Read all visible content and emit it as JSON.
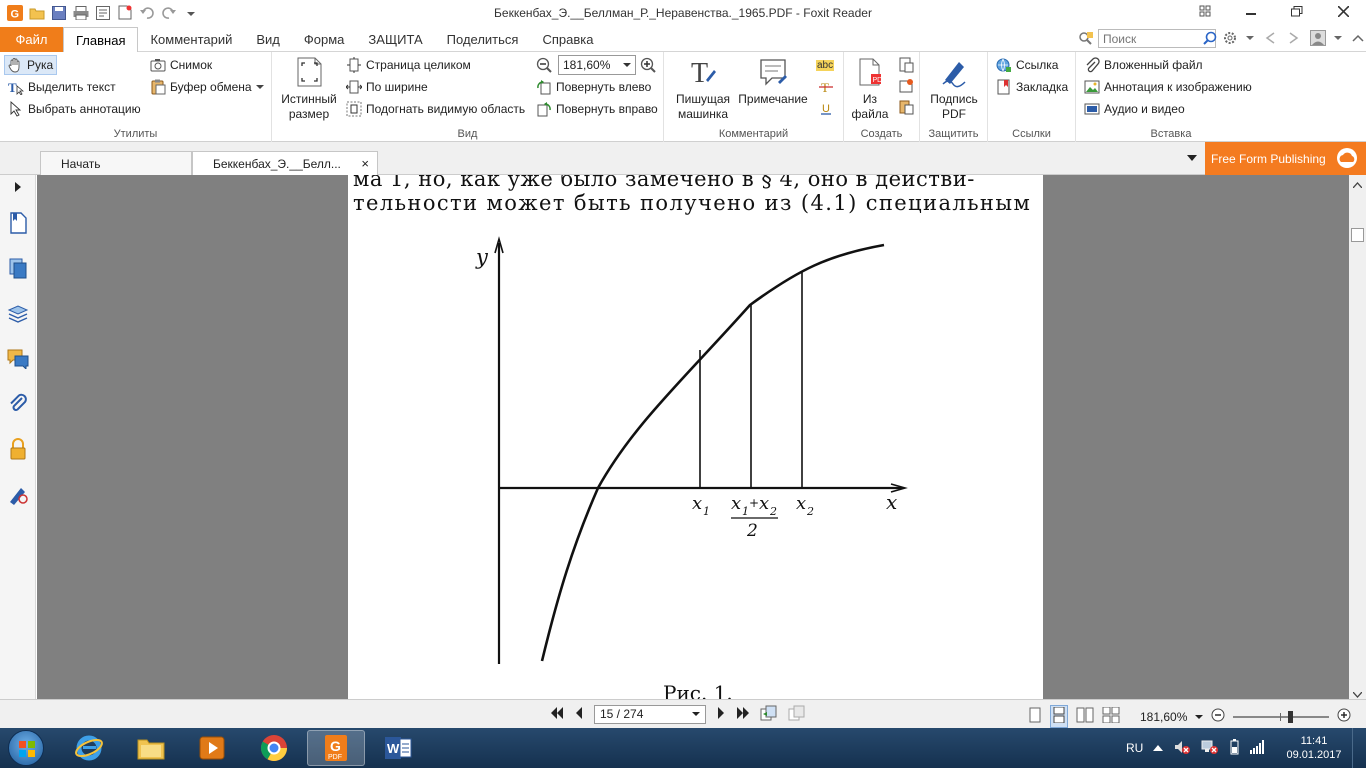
{
  "window": {
    "title": "Беккенбах_Э.__Беллман_Р._Неравенства._1965.PDF - Foxit Reader"
  },
  "menu": {
    "file": "Файл",
    "tabs": [
      "Главная",
      "Комментарий",
      "Вид",
      "Форма",
      "ЗАЩИТА",
      "Поделиться",
      "Справка"
    ]
  },
  "search": {
    "placeholder": "Поиск"
  },
  "ribbon": {
    "utilities": {
      "label": "Утилиты",
      "hand": "Рука",
      "select_text": "Выделить текст",
      "select_annotation": "Выбрать аннотацию",
      "snapshot": "Снимок",
      "clipboard": "Буфер обмена"
    },
    "view": {
      "label": "Вид",
      "actual_size": "Истинный размер",
      "fit_page": "Страница целиком",
      "fit_width": "По ширине",
      "fit_visible": "Подогнать видимую область",
      "zoom": "181,60%",
      "rotate_left": "Повернуть влево",
      "rotate_right": "Повернуть вправо"
    },
    "comment": {
      "label": "Комментарий",
      "typewriter": "Пишущая машинка",
      "note": "Примечание",
      "abc": "abc"
    },
    "create": {
      "label": "Создать",
      "from_file": "Из файла"
    },
    "protect": {
      "label": "Защитить",
      "sign_pdf": "Подпись PDF"
    },
    "links": {
      "label": "Ссылки",
      "link": "Ссылка",
      "bookmark": "Закладка"
    },
    "insert": {
      "label": "Вставка",
      "attached_file": "Вложенный файл",
      "image_annotation": "Аннотация к изображению",
      "audio_video": "Аудио и видео"
    }
  },
  "doc_tabs": {
    "start": "Начать",
    "document": "Беккенбах_Э.__Белл...",
    "close": "×",
    "promo": "Free Form Publishing"
  },
  "page": {
    "line1": "ма 1, но, как уже было замечено в § 4, оно в действи-",
    "line2": "тельности может быть получено из (4.1) специальным",
    "caption": "Рис. 1.",
    "figure": {
      "y_label": "y",
      "x_label": "x",
      "x1_label": "x",
      "x1_sub": "1",
      "mid_num_a": "x",
      "mid_num_a_sub": "1",
      "mid_plus": "+",
      "mid_num_b": "x",
      "mid_num_b_sub": "2",
      "mid_den": "2",
      "x2_label": "x",
      "x2_sub": "2"
    }
  },
  "statusbar": {
    "page_indicator": "15 / 274",
    "zoom": "181,60%"
  },
  "taskbar": {
    "language": "RU",
    "time": "11:41",
    "date": "09.01.2017"
  },
  "colors": {
    "accent_orange": "#f07d1a",
    "promo_orange": "#f47b20",
    "doc_background": "#808080",
    "taskbar": "#1c3b5e"
  }
}
